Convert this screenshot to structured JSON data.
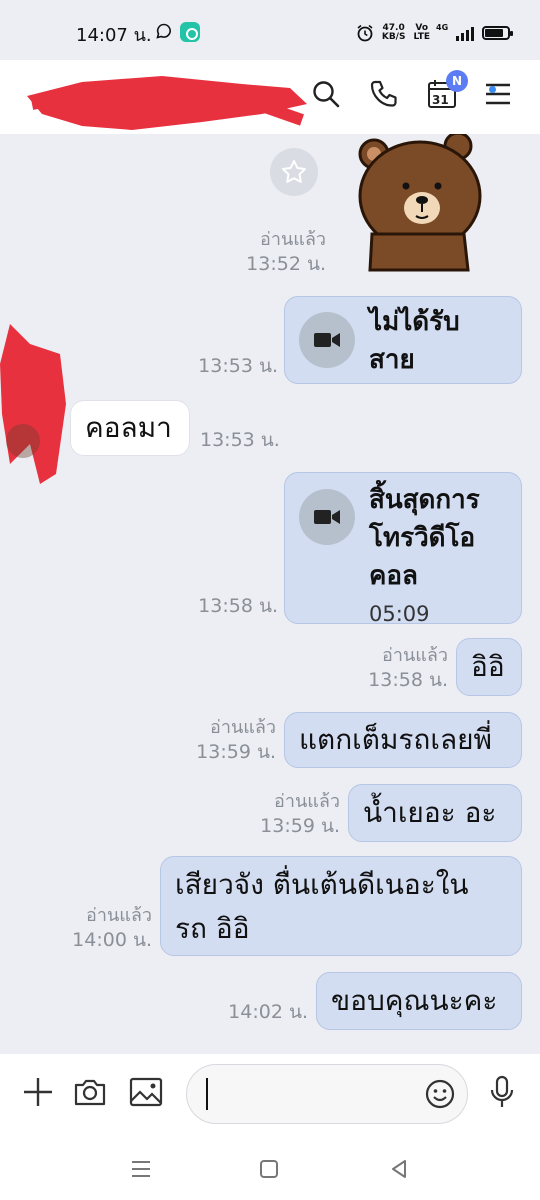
{
  "status_bar": {
    "time": "14:07 น.",
    "speed_value": "47.0",
    "speed_unit": "KB/S",
    "volte_top": "Vo",
    "volte_bottom": "LTE",
    "network": "4G"
  },
  "header": {
    "title_redacted": true,
    "calendar_day": "31",
    "calendar_badge": "N"
  },
  "messages": [
    {
      "id": "m1",
      "direction": "out",
      "type": "call",
      "text": "ไม่ได้รับ\nสาย",
      "lines": [
        "ไม่ได้รับ",
        "สาย"
      ],
      "time": "13:53 น.",
      "read": ""
    },
    {
      "id": "m2",
      "direction": "in",
      "type": "text",
      "text": "คอลมา",
      "time": "13:53 น."
    },
    {
      "id": "m3",
      "direction": "out",
      "type": "call",
      "lines": [
        "สิ้นสุดการ",
        "โทรวิดีโอ",
        "คอล"
      ],
      "duration": "05:09",
      "time": "13:58 น.",
      "read": ""
    },
    {
      "id": "m4",
      "direction": "out",
      "type": "text",
      "text": "อิอิ",
      "time": "13:58 น.",
      "read": "อ่านแล้ว"
    },
    {
      "id": "m5",
      "direction": "out",
      "type": "text",
      "text": "แตกเต็มรถเลยพี่",
      "time": "13:59 น.",
      "read": "อ่านแล้ว"
    },
    {
      "id": "m6",
      "direction": "out",
      "type": "text",
      "text": "น้ำเยอะ อะ",
      "time": "13:59 น.",
      "read": "อ่านแล้ว"
    },
    {
      "id": "m7",
      "direction": "out",
      "type": "text",
      "lines": [
        "เสียวจัง ตื่นเต้นดีเนอะใน",
        "รถ อิอิ"
      ],
      "time": "14:00 น.",
      "read": "อ่านแล้ว"
    },
    {
      "id": "m8",
      "direction": "out",
      "type": "text",
      "text": "ขอบคุณนะคะ",
      "time": "14:02 น.",
      "read": ""
    }
  ],
  "sticker_meta": {
    "read": "อ่านแล้ว",
    "time": "13:52 น."
  },
  "input": {
    "value": "",
    "placeholder": ""
  },
  "colors": {
    "outgoing_bubble": "#d3ddf2",
    "incoming_bubble": "#ffffff",
    "badge": "#5b7cf2",
    "background": "#eceef3"
  }
}
